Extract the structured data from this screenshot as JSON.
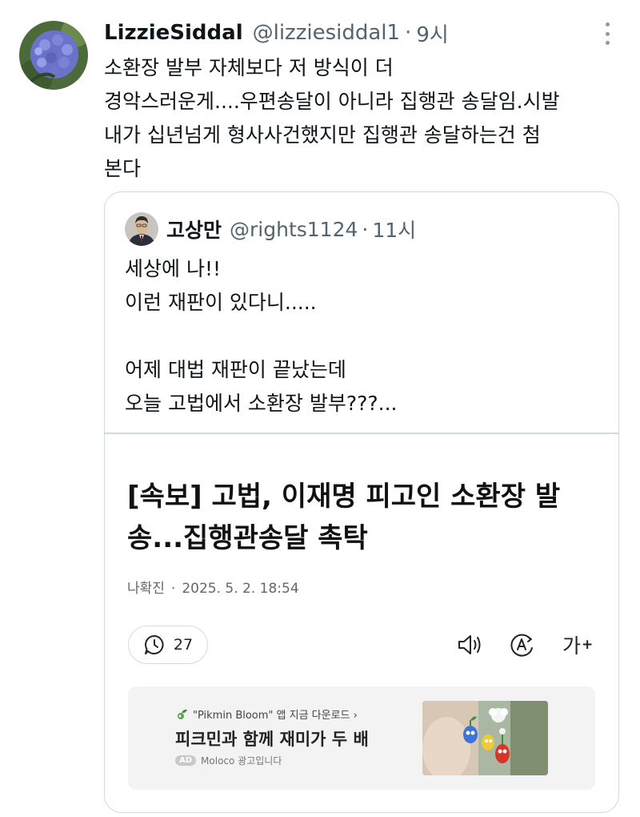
{
  "tweet": {
    "display_name": "LizzieSiddal",
    "handle": "@lizziesiddal1",
    "separator": "·",
    "time": "9시",
    "text_lines": [
      "소환장 발부 자체보다 저 방식이 더",
      "경악스러운게....우편송달이 아니라 집행관 송달임.시발",
      "내가 십년넘게 형사사건했지만 집행관 송달하는건 첨",
      "본다"
    ]
  },
  "quote": {
    "display_name": "고상만",
    "handle": "@rights1124",
    "separator": "·",
    "time": "11시",
    "text_lines": [
      "세상에 나!!",
      "이런 재판이 있다니.....",
      "",
      "어제 대법 재판이 끝났는데",
      "오늘 고법에서 소환장 발부???..."
    ]
  },
  "article": {
    "title_lines": [
      "[속보] 고법, 이재명 피고인 소환장 발",
      "송...집행관송달 촉탁"
    ],
    "reporter": "나확진",
    "meta_separator": "·",
    "date": "2025. 5. 2. 18:54",
    "comment_count": "27",
    "font_tool_label": "가",
    "font_tool_plus": "+"
  },
  "ad": {
    "source": "\"Pikmin Bloom\" 앱 지금 다운로드 ›",
    "title": "피크민과 함께 재미가 두 배",
    "badge": "AD",
    "sponsor": "Moloco 광고입니다"
  },
  "icons": {
    "more": "more-dots-icon",
    "comment": "comment-clock-icon",
    "speaker": "speaker-icon",
    "translate": "translate-icon",
    "font_size": "font-size-icon",
    "leaf": "pikmin-leaf-icon"
  },
  "colors": {
    "text_primary": "#0f1419",
    "text_secondary": "#536471",
    "border": "#cfd9de",
    "ad_background": "#f3f3f4"
  }
}
